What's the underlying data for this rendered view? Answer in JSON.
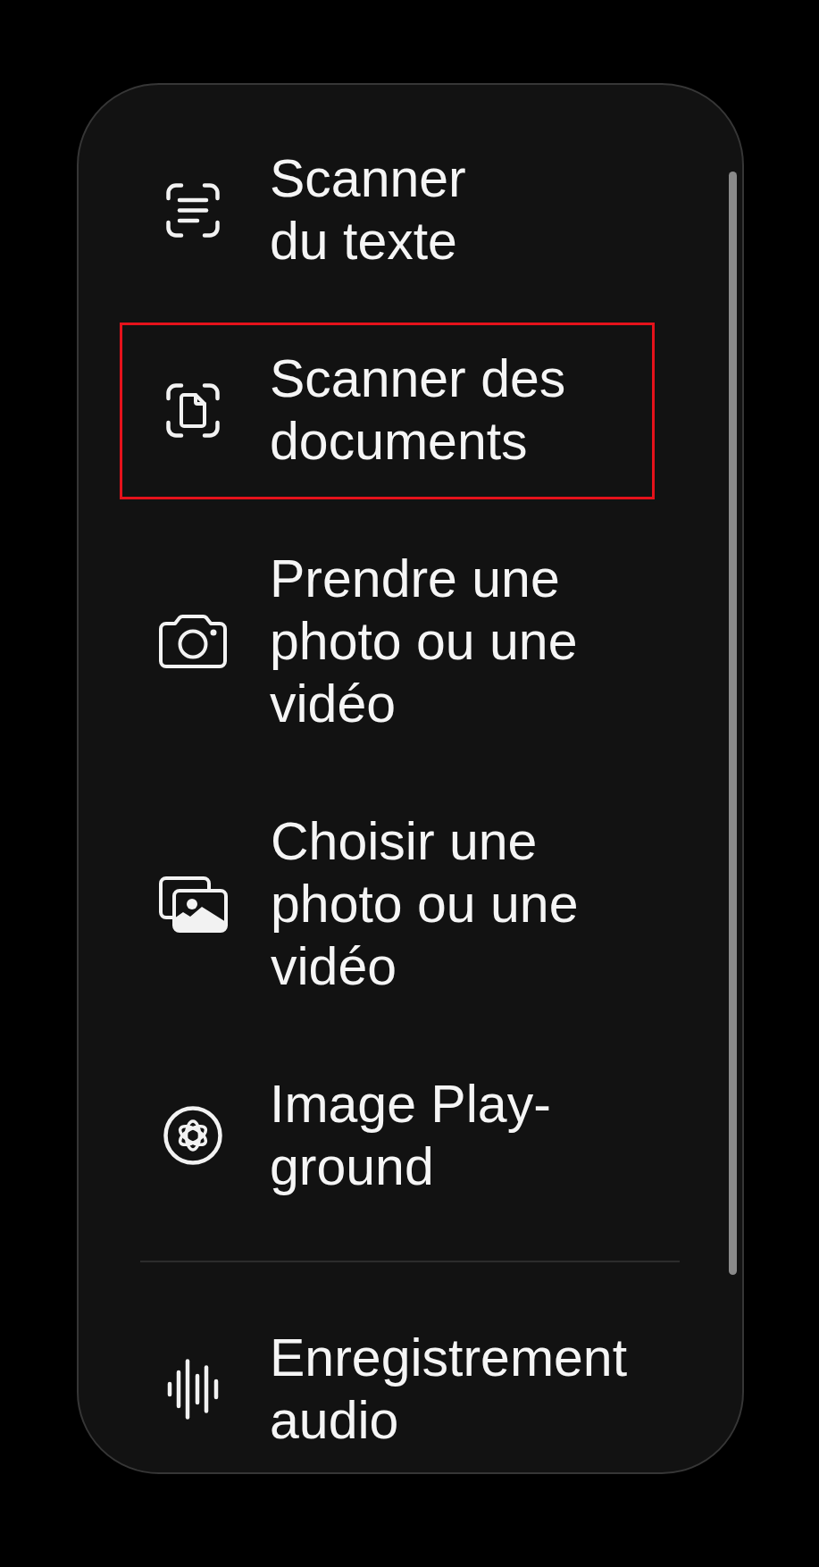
{
  "menu": {
    "sections": [
      {
        "items": [
          {
            "kind": "text",
            "lines": [
              "Scanner",
              "du texte"
            ],
            "highlighted": false
          },
          {
            "kind": "document",
            "lines": [
              "Scanner des",
              "documents"
            ],
            "highlighted": true
          },
          {
            "kind": "camera",
            "lines": [
              "Prendre une",
              "photo ou une",
              "vidéo"
            ],
            "highlighted": false
          },
          {
            "kind": "gallery",
            "lines": [
              "Choisir une",
              "photo ou une",
              "vidéo"
            ],
            "highlighted": false
          },
          {
            "kind": "playground",
            "lines": [
              "Image Play-",
              "ground"
            ],
            "highlighted": false
          }
        ]
      },
      {
        "items": [
          {
            "kind": "audio",
            "lines": [
              "Enregistrement",
              "audio"
            ],
            "highlighted": false
          }
        ]
      }
    ]
  }
}
